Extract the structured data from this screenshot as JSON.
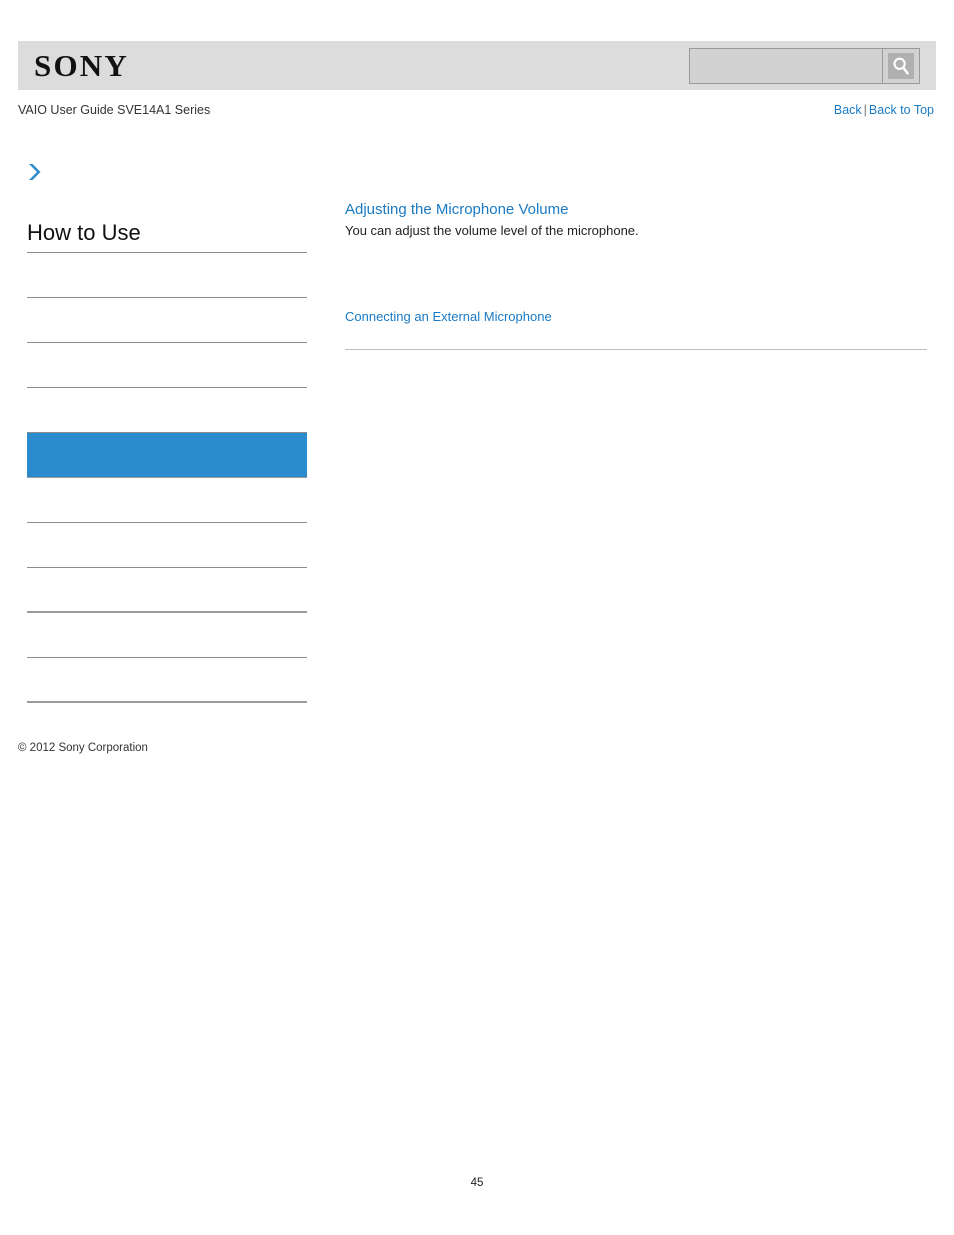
{
  "header": {
    "logo_text": "SONY",
    "logo_icon": "sony-wordmark",
    "search": {
      "value": "",
      "placeholder": "",
      "icon": "magnifier-icon"
    }
  },
  "subheader": {
    "guide_title": "VAIO User Guide SVE14A1 Series",
    "back_label": "Back",
    "separator": "|",
    "back_to_top_label": "Back to Top"
  },
  "breadcrumb": {
    "icon": "chevron-right-icon",
    "text": ""
  },
  "sidebar": {
    "heading": "How to Use",
    "items": [
      {
        "label": "",
        "selected": false,
        "thick_rule": false
      },
      {
        "label": "",
        "selected": false,
        "thick_rule": false
      },
      {
        "label": "",
        "selected": false,
        "thick_rule": false
      },
      {
        "label": "",
        "selected": false,
        "thick_rule": false
      },
      {
        "label": "",
        "selected": true,
        "thick_rule": false
      },
      {
        "label": "",
        "selected": false,
        "thick_rule": false
      },
      {
        "label": "",
        "selected": false,
        "thick_rule": false
      },
      {
        "label": "",
        "selected": false,
        "thick_rule": true
      },
      {
        "label": "",
        "selected": false,
        "thick_rule": false
      },
      {
        "label": "",
        "selected": false,
        "thick_rule": true
      }
    ]
  },
  "main": {
    "article_title": "Adjusting the Microphone Volume",
    "article_description": "You can adjust the volume level of the microphone.",
    "related_link": "Connecting an External Microphone"
  },
  "footer": {
    "copyright": "© 2012 Sony Corporation",
    "page_number": "45"
  },
  "colors": {
    "accent_blue": "#2b8ccd",
    "link_blue": "#1a7ac4",
    "header_band": "#dcdcdc",
    "rule_gray": "#8c8c8c"
  }
}
